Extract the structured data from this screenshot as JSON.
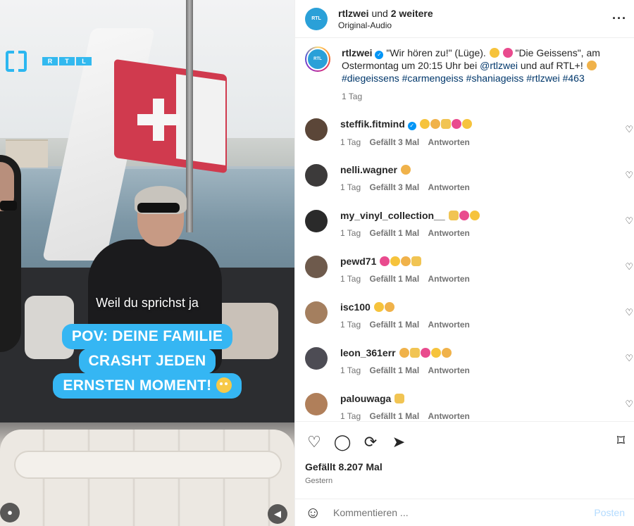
{
  "header": {
    "username": "rtlzwei",
    "and_text": " und ",
    "others": "2 weitere",
    "audio": "Original-Audio",
    "more_icon": "more-icon"
  },
  "video": {
    "subtitle": "Weil du sprichst ja",
    "pov_line1": "POV: DEINE FAMILIE",
    "pov_line2": "CRASHT JEDEN",
    "pov_line3": "ERNSTEN MOMENT!",
    "rtl_letters": [
      "R",
      "T",
      "L"
    ],
    "accent_color": "#35b6f3"
  },
  "caption": {
    "username": "rtlzwei",
    "text_part1": " \"Wir hören zu!\" (Lüge). ",
    "text_part2": " \"Die Geissens\", am Ostermontag um 20:15 Uhr bei ",
    "mention": "@rtlzwei",
    "text_part3": " und auf RTL+! ",
    "hashtags": "#diegeissens #carmengeiss #shaniageiss #rtlzwei #463",
    "time": "1 Tag"
  },
  "comments": [
    {
      "user": "steffik.fitmind",
      "verified": true,
      "emoji_count": 5,
      "time": "1 Tag",
      "likes": "Gefällt 3 Mal",
      "reply": "Antworten",
      "avatar_color": "#5b4638"
    },
    {
      "user": "nelli.wagner",
      "verified": false,
      "emoji_count": 1,
      "time": "1 Tag",
      "likes": "Gefällt 3 Mal",
      "reply": "Antworten",
      "avatar_color": "#3c3a3a"
    },
    {
      "user": "my_vinyl_collection__",
      "verified": false,
      "emoji_count": 3,
      "time": "1 Tag",
      "likes": "Gefällt 1 Mal",
      "reply": "Antworten",
      "avatar_color": "#2a2a2a"
    },
    {
      "user": "pewd71",
      "verified": false,
      "emoji_count": 4,
      "time": "1 Tag",
      "likes": "Gefällt 1 Mal",
      "reply": "Antworten",
      "avatar_color": "#6e5a4c"
    },
    {
      "user": "isc100",
      "verified": false,
      "emoji_count": 2,
      "time": "1 Tag",
      "likes": "Gefällt 1 Mal",
      "reply": "Antworten",
      "avatar_color": "#a47f5f"
    },
    {
      "user": "leon_361err",
      "verified": false,
      "emoji_count": 5,
      "time": "1 Tag",
      "likes": "Gefällt 1 Mal",
      "reply": "Antworten",
      "avatar_color": "#4d4c54"
    },
    {
      "user": "palouwaga",
      "verified": false,
      "emoji_count": 1,
      "time": "1 Tag",
      "likes": "Gefällt 1 Mal",
      "reply": "Antworten",
      "avatar_color": "#b07f5a"
    }
  ],
  "actions": {
    "likes": "Gefällt 8.207 Mal",
    "date": "Gestern",
    "icons": [
      "heart-icon",
      "comment-icon",
      "repost-icon",
      "share-icon",
      "bookmark-icon"
    ]
  },
  "comment_bar": {
    "placeholder": "Kommentieren ...",
    "post_label": "Posten",
    "post_color": "#b3dbff"
  }
}
